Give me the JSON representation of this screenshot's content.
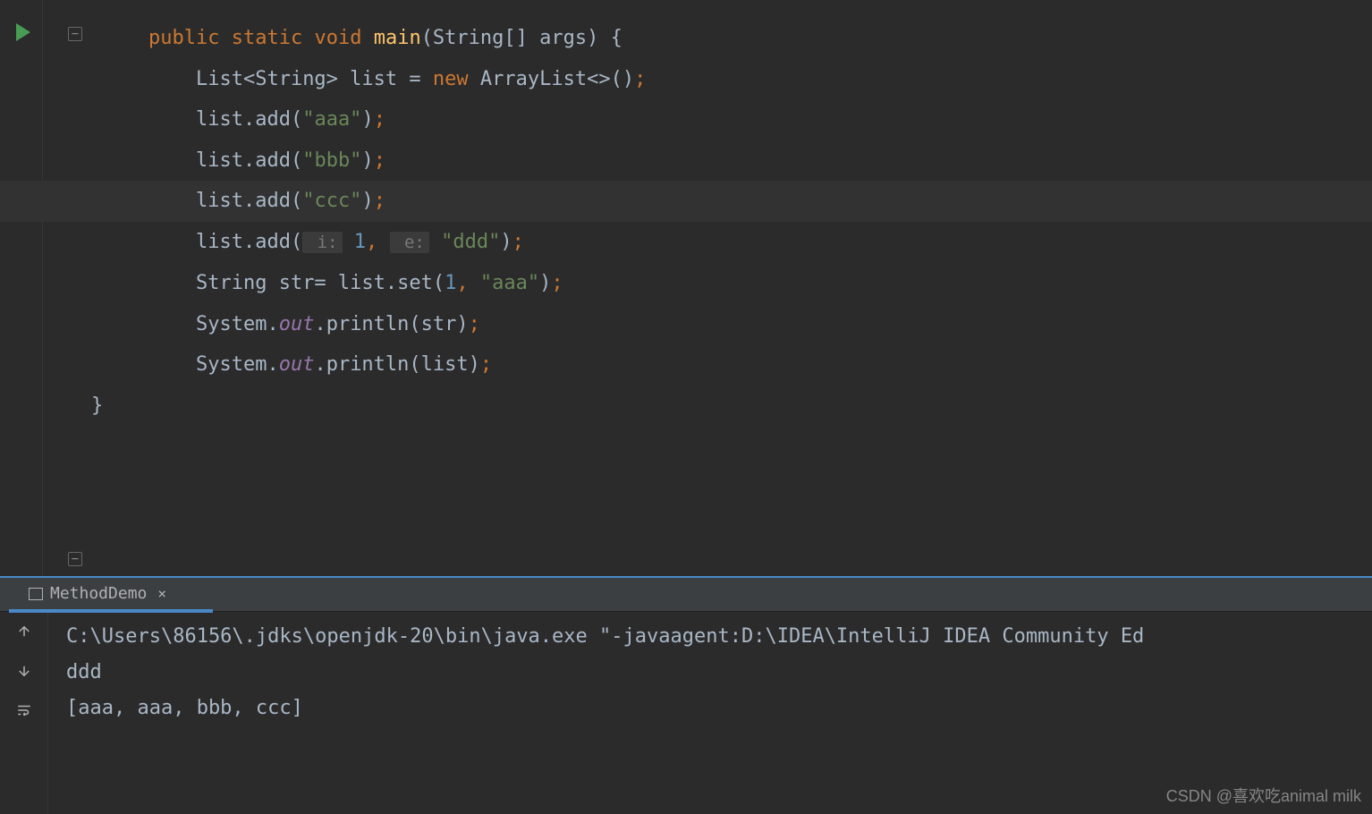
{
  "code": {
    "line1": {
      "public": "public",
      "static": "static",
      "void": "void",
      "main": "main",
      "sig_open": "(String[] args) {"
    },
    "line2": {
      "text": "List<String> list = ",
      "new": "new",
      "rest": " ArrayList<>()",
      "semi": ";"
    },
    "line3": {
      "call": "list.add(",
      "str": "\"aaa\"",
      "close": ")",
      "semi": ";"
    },
    "line4": {
      "call": "list.add(",
      "str": "\"bbb\"",
      "close": ")",
      "semi": ";"
    },
    "line5": {
      "call": "list.add(",
      "str": "\"ccc\"",
      "close": ")",
      "semi": ";"
    },
    "line6": {
      "call": "list.add(",
      "hint1": " i:",
      "arg1": " 1",
      "comma": ",",
      "hint2": " e:",
      "arg2": " \"ddd\"",
      "close": ")",
      "semi": ";"
    },
    "line7": {
      "decl": "String str= list.set(",
      "arg1": "1",
      "comma": ", ",
      "str": "\"aaa\"",
      "close": ")",
      "semi": ";"
    },
    "line8": {
      "sys": "System.",
      "out": "out",
      "rest": ".println(str)",
      "semi": ";"
    },
    "line9": {
      "sys": "System.",
      "out": "out",
      "rest": ".println(list)",
      "semi": ";"
    },
    "line10": {
      "brace": "}"
    }
  },
  "run_tab": {
    "name": "MethodDemo",
    "close": "×"
  },
  "console": {
    "line1": "C:\\Users\\86156\\.jdks\\openjdk-20\\bin\\java.exe \"-javaagent:D:\\IDEA\\IntelliJ IDEA Community Ed",
    "line2": "ddd",
    "line3": "[aaa, aaa, bbb, ccc]"
  },
  "watermark": "CSDN @喜欢吃animal milk"
}
